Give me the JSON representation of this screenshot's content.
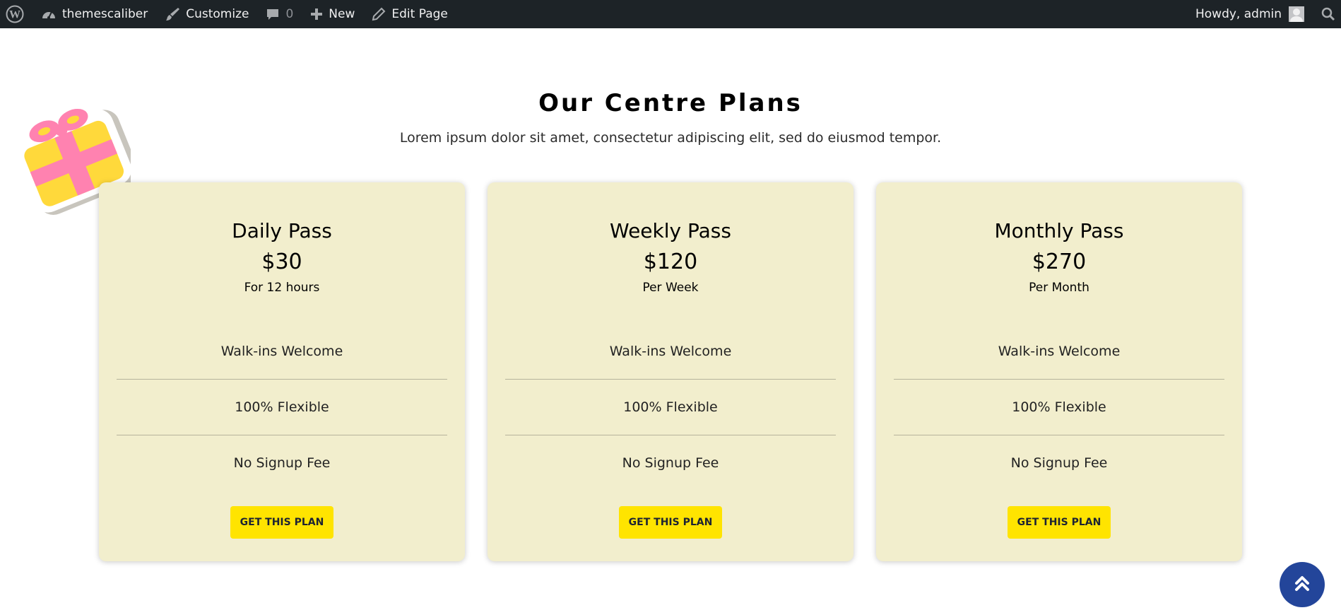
{
  "adminbar": {
    "site_name": "themescaliber",
    "customize": "Customize",
    "comments_count": "0",
    "new": "New",
    "edit_page": "Edit Page",
    "greeting": "Howdy, admin",
    "icons": [
      "wordpress-logo-icon",
      "dashboard-icon",
      "brush-icon",
      "comment-icon",
      "plus-icon",
      "pencil-icon",
      "search-icon"
    ]
  },
  "section": {
    "title": "Our Centre Plans",
    "subtitle": "Lorem ipsum dolor sit amet, consectetur adipiscing elit, sed do eiusmod tempor."
  },
  "plans": [
    {
      "name": "Daily Pass",
      "price": "$30",
      "period": "For 12 hours",
      "features": [
        "Walk-ins Welcome",
        "100% Flexible",
        "No Signup Fee"
      ],
      "button": "GET THIS PLAN"
    },
    {
      "name": "Weekly Pass",
      "price": "$120",
      "period": "Per Week",
      "features": [
        "Walk-ins Welcome",
        "100% Flexible",
        "No Signup Fee"
      ],
      "button": "GET THIS PLAN"
    },
    {
      "name": "Monthly Pass",
      "price": "$270",
      "period": "Per Month",
      "features": [
        "Walk-ins Welcome",
        "100% Flexible",
        "No Signup Fee"
      ],
      "button": "GET THIS PLAN"
    }
  ],
  "colors": {
    "adminbar_bg": "#1d2327",
    "card_bg": "#f2eecd",
    "button_bg": "#ffe400",
    "scroll_top_bg": "#23459a",
    "gift_box": "#ffd93b",
    "gift_ribbon": "#ff82b0"
  }
}
